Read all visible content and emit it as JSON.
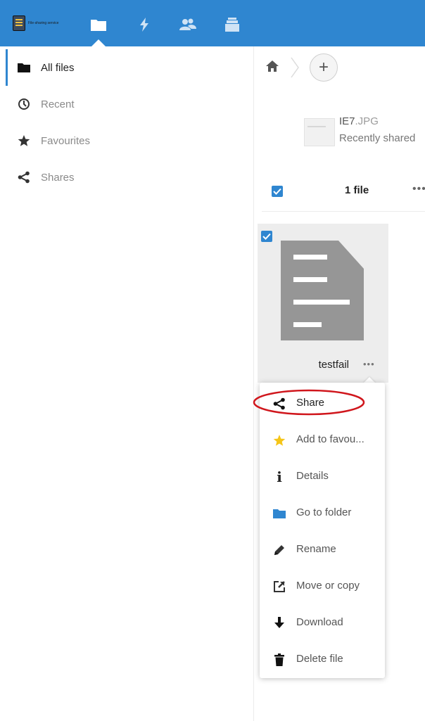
{
  "header": {
    "logo_text": "File-sharing service",
    "apps": [
      {
        "name": "files-app-icon"
      },
      {
        "name": "activity-app-icon"
      },
      {
        "name": "contacts-app-icon"
      },
      {
        "name": "deck-app-icon"
      }
    ],
    "colors": {
      "primary": "#2f86d0"
    }
  },
  "sidebar": {
    "items": [
      {
        "label": "All files",
        "icon": "folder-icon",
        "active": true
      },
      {
        "label": "Recent",
        "icon": "clock-icon"
      },
      {
        "label": "Favourites",
        "icon": "star-icon"
      },
      {
        "label": "Shares",
        "icon": "share-icon"
      }
    ]
  },
  "breadcrumb": {
    "home_icon": "home-icon",
    "add_label": "+"
  },
  "recent": {
    "file_name": "IE7",
    "file_ext": ".JPG",
    "status": "Recently shared"
  },
  "selection": {
    "count_label": "1 file",
    "more_label": "•••"
  },
  "file": {
    "name": "testfail",
    "more_label": "•••"
  },
  "menu": {
    "items": [
      {
        "label": "Share",
        "icon": "share-icon"
      },
      {
        "label": "Add to favou...",
        "icon": "star-icon"
      },
      {
        "label": "Details",
        "icon": "info-icon"
      },
      {
        "label": "Go to folder",
        "icon": "folder-icon"
      },
      {
        "label": "Rename",
        "icon": "pencil-icon"
      },
      {
        "label": "Move or copy",
        "icon": "external-link-icon"
      },
      {
        "label": "Download",
        "icon": "download-icon"
      },
      {
        "label": "Delete file",
        "icon": "trash-icon"
      }
    ],
    "colors": {
      "star": "#f5c518",
      "folder": "#2f86d0",
      "annotation": "#d0161c"
    }
  }
}
